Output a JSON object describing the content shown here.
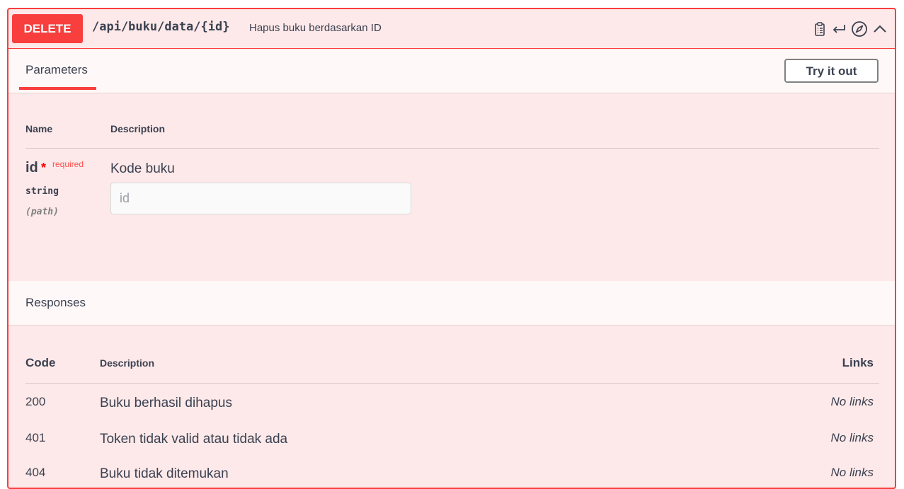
{
  "operation": {
    "method": "DELETE",
    "path": "/api/buku/data/{id}",
    "summary": "Hapus buku berdasarkan ID",
    "method_color": "#f93e3e",
    "background_color": "#fde9e9"
  },
  "header_icons": [
    "clipboard-icon",
    "return-arrow-icon",
    "compass-icon",
    "chevron-up-icon"
  ],
  "parameters": {
    "tab_label": "Parameters",
    "try_button_label": "Try it out",
    "columns": {
      "name": "Name",
      "description": "Description"
    },
    "items": [
      {
        "name": "id",
        "required_star": "*",
        "required_label": "required",
        "type": "string",
        "in": "(path)",
        "description": "Kode buku",
        "placeholder": "id",
        "value": ""
      }
    ]
  },
  "responses": {
    "title": "Responses",
    "columns": {
      "code": "Code",
      "description": "Description",
      "links": "Links"
    },
    "rows": [
      {
        "code": "200",
        "description": "Buku berhasil dihapus",
        "links": "No links"
      },
      {
        "code": "401",
        "description": "Token tidak valid atau tidak ada",
        "links": "No links"
      },
      {
        "code": "404",
        "description": "Buku tidak ditemukan",
        "links": "No links"
      }
    ]
  }
}
